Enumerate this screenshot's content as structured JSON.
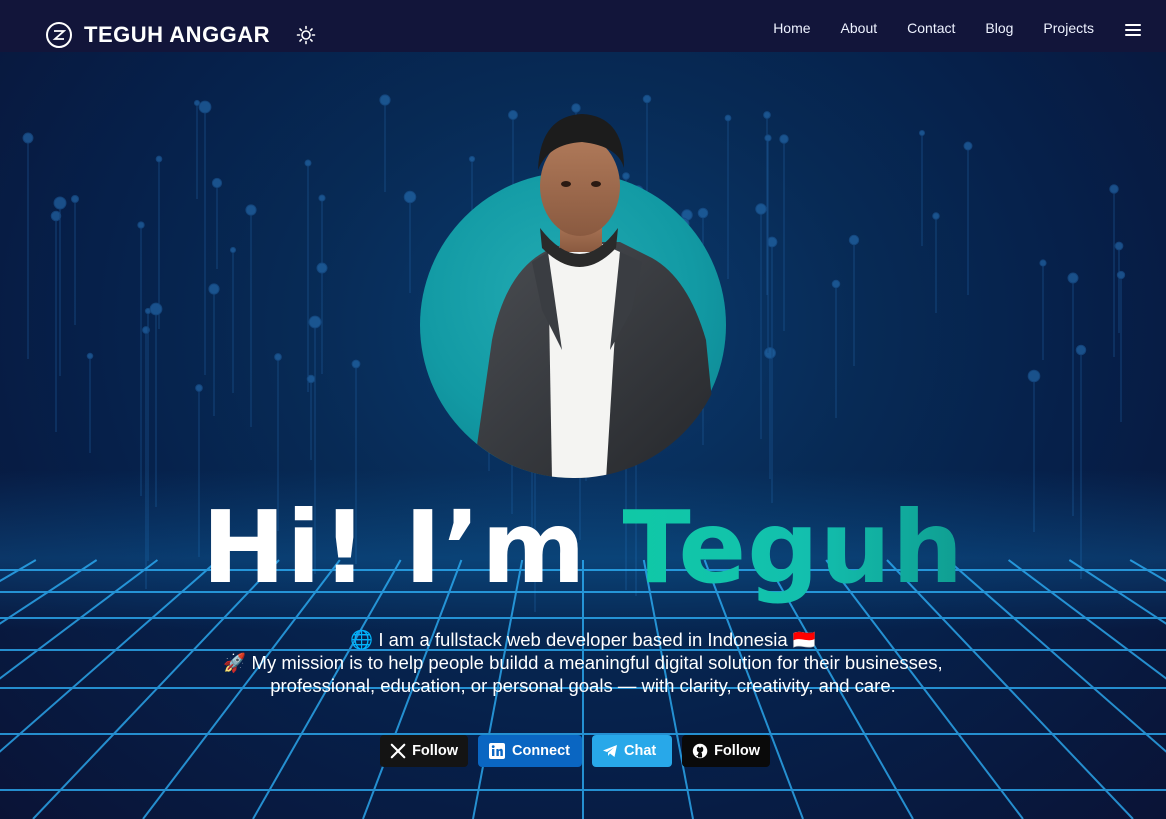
{
  "navbar": {
    "brand": {
      "name": "TEGUH ANGGAR",
      "logo_icon": "brand-logo-icon"
    },
    "theme_toggle_icon": "sun-icon",
    "links": [
      {
        "label": "Home"
      },
      {
        "label": "About"
      },
      {
        "label": "Contact"
      },
      {
        "label": "Blog"
      },
      {
        "label": "Projects"
      }
    ],
    "menu_icon": "hamburger-menu-icon"
  },
  "hero": {
    "greeting": "Hi! I’m",
    "name": "Teguh",
    "bio": {
      "line1": "🌐 I am a fullstack web developer based in Indonesia 🇮🇩",
      "line2": "🚀 My mission is to help people buildd a meaningful digital solution for their businesses,",
      "line3": "professional, education, or personal goals — with clarity, creativity, and care."
    }
  },
  "socials": [
    {
      "label": "Follow",
      "icon": "x-icon",
      "color": "#141414"
    },
    {
      "label": "Connect",
      "icon": "linkedin-icon",
      "color": "#0a66c2"
    },
    {
      "label": "Chat",
      "icon": "telegram-icon",
      "color": "#28a8e9"
    },
    {
      "label": "Follow",
      "icon": "github-icon",
      "color": "#0a0a0a"
    }
  ],
  "colors": {
    "navbar_bg": "#12153a",
    "accent": "#13bfae",
    "avatar_circle": "#129aa4"
  }
}
